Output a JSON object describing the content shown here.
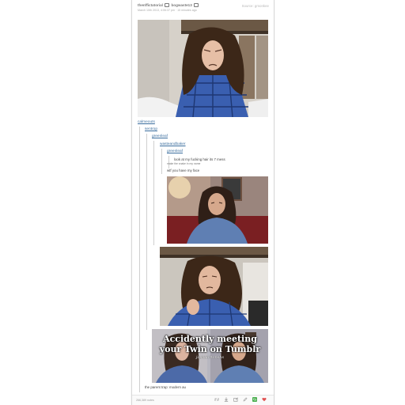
{
  "header": {
    "username": "thenffictatorial",
    "reblogged_from": "bogwaste13",
    "meta": "March 10th 2013, 4:06:37 pm · 15 minutes ago",
    "follow_label": "Source: gmonkee"
  },
  "thread": {
    "user1": "calmeouts",
    "user2": "sentrop",
    "user3": "greenleaf",
    "user4": "wasteandbaker",
    "user5": "greenleaf",
    "post_text": "look at my fucking hair its 7 mess",
    "post_subtext": "make the snake in my name",
    "reply_text": "wtf you have my face",
    "gif_caption_line1": "Accidently meeting",
    "gif_caption_line2": "your Twin on Tumblr",
    "gif_watermark": "joshikittonshs",
    "tag_line": "the parent trap: modern au"
  },
  "footer": {
    "notes": "266,389 notes"
  },
  "icons": [
    "reblog-icon",
    "download-icon",
    "share-icon",
    "edit-icon",
    "retweet-icon",
    "heart-icon"
  ],
  "colors": {
    "link": "#3b6e9e",
    "heart": "#e05050",
    "retweet": "#4caf50",
    "shirt": "#3a5fb0"
  }
}
